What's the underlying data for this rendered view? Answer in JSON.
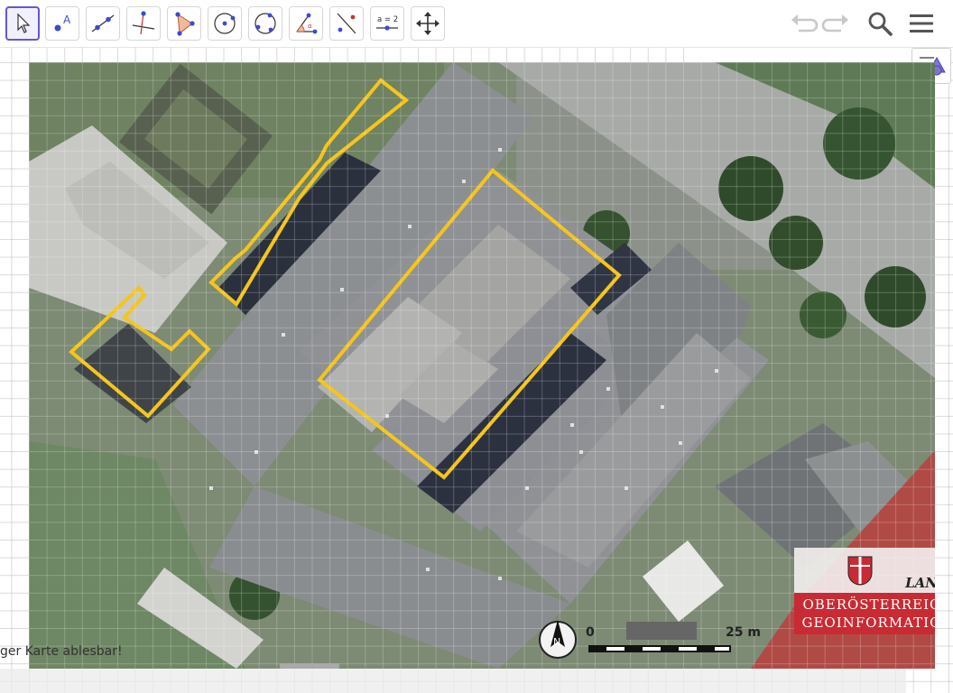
{
  "toolbar": {
    "tools": [
      {
        "id": "move",
        "icon": "cursor-arrow-icon",
        "active": true
      },
      {
        "id": "point",
        "icon": "point-with-label-icon",
        "label": "A"
      },
      {
        "id": "line",
        "icon": "line-through-two-points-icon"
      },
      {
        "id": "perpendicular",
        "icon": "perpendicular-line-icon"
      },
      {
        "id": "polygon",
        "icon": "polygon-icon"
      },
      {
        "id": "circle",
        "icon": "circle-center-point-icon"
      },
      {
        "id": "ellipse",
        "icon": "circle-through-three-points-icon"
      },
      {
        "id": "angle",
        "icon": "angle-icon"
      },
      {
        "id": "reflect",
        "icon": "reflect-about-line-icon"
      },
      {
        "id": "slider",
        "icon": "slider-icon",
        "label": "a = 2"
      },
      {
        "id": "move-graphics",
        "icon": "move-graphics-view-icon"
      }
    ],
    "right": [
      "undo-icon",
      "redo-icon",
      "search-icon",
      "menu-icon"
    ]
  },
  "map": {
    "caption": "ger Karte ablesbar!",
    "scale": {
      "zero": "0",
      "distance": "25 m"
    },
    "logo": {
      "land": "LAND",
      "line1": "OBERÖSTERREICH",
      "line2": "GEOINFORMATION"
    },
    "highlight_color": "#f5c518"
  }
}
